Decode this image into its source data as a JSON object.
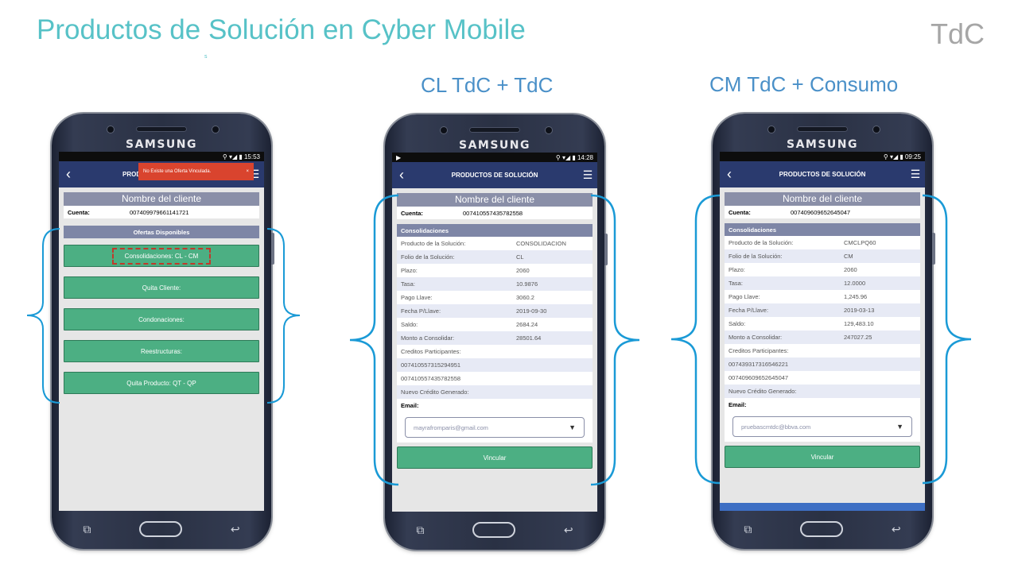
{
  "slide": {
    "title": "Productos de Solución en Cyber Mobile",
    "tag": "TdC",
    "mark": "s"
  },
  "columns": [
    {
      "subtitle": ""
    },
    {
      "subtitle": "CL TdC + TdC"
    },
    {
      "subtitle": "CM TdC + Consumo"
    }
  ],
  "phone1": {
    "brand": "SAMSUNG",
    "time": "15:53",
    "title": "PROD",
    "toast": "No Existe una Oferta Vinculada.",
    "toast_close": "×",
    "client_name": "Nombre del cliente",
    "account_label": "Cuenta:",
    "account": "007409979661141721",
    "offers_header": "Ofertas Disponibles",
    "offers": [
      "Consolidaciones: CL - CM",
      "Quita Cliente:",
      "Condonaciones:",
      "Reestructuras:",
      "Quita Producto: QT - QP"
    ]
  },
  "phone2": {
    "brand": "SAMSUNG",
    "time": "14:28",
    "title": "PRODUCTOS DE SOLUCIÓN",
    "client_name": "Nombre del cliente",
    "account_label": "Cuenta:",
    "account": "007410557435782558",
    "section": "Consolidaciones",
    "rows": [
      {
        "k": "Producto de la Solución:",
        "v": "CONSOLIDACION"
      },
      {
        "k": "Folio de la Solución:",
        "v": "CL"
      },
      {
        "k": "Plazo:",
        "v": "2060"
      },
      {
        "k": "Tasa:",
        "v": "10.9876"
      },
      {
        "k": "Pago Llave:",
        "v": "3060.2"
      },
      {
        "k": "Fecha P/Llave:",
        "v": "2019-09-30"
      },
      {
        "k": "Saldo:",
        "v": "2684.24"
      },
      {
        "k": "Monto a Consolidar:",
        "v": "28501.64"
      },
      {
        "k": "Creditos Participantes:",
        "v": ""
      },
      {
        "k": "007410557315294951",
        "v": ""
      },
      {
        "k": "007410557435782558",
        "v": ""
      },
      {
        "k": "Nuevo Crédito Generado:",
        "v": ""
      }
    ],
    "email_label": "Email:",
    "email": "mayrafromparis@gmail.com",
    "button": "Vincular"
  },
  "phone3": {
    "brand": "SAMSUNG",
    "time": "09:25",
    "title": "PRODUCTOS DE SOLUCIÓN",
    "client_name": "Nombre del cliente",
    "account_label": "Cuenta:",
    "account": "007409609652645047",
    "section": "Consolidaciones",
    "rows": [
      {
        "k": "Producto de la Solución:",
        "v": "CMCLPQ60"
      },
      {
        "k": "Folio de la Solución:",
        "v": "CM"
      },
      {
        "k": "Plazo:",
        "v": "2060"
      },
      {
        "k": "Tasa:",
        "v": "12.0000"
      },
      {
        "k": "Pago Llave:",
        "v": "1,245.96"
      },
      {
        "k": "Fecha P/Llave:",
        "v": "2019-03-13"
      },
      {
        "k": "Saldo:",
        "v": "129,483.10"
      },
      {
        "k": "Monto a Consolidar:",
        "v": "247027.25"
      },
      {
        "k": "Creditos Participantes:",
        "v": ""
      },
      {
        "k": "007439317316546221",
        "v": ""
      },
      {
        "k": "007409609652645047",
        "v": ""
      },
      {
        "k": "Nuevo Crédito Generado:",
        "v": ""
      }
    ],
    "email_label": "Email:",
    "email": "pruebascmtdc@bbva.com",
    "button": "Vincular"
  },
  "colors": {
    "title": "#57c2c7",
    "subtitle": "#4a90c8",
    "appbar": "#2a3a6e",
    "button": "#4caf83",
    "brace": "#1a9ad6",
    "toast": "#d9442e"
  }
}
